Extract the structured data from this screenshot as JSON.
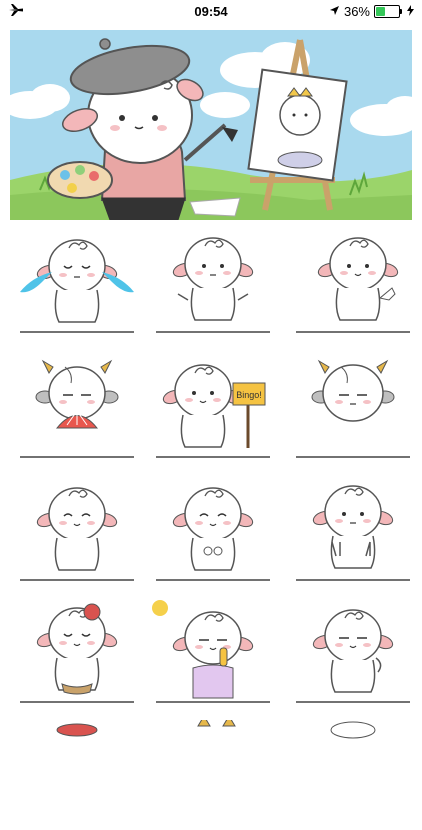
{
  "status_bar": {
    "time": "09:54",
    "battery_percent": "36%",
    "battery_level": 0.36,
    "icons": [
      "airplane-icon",
      "location-arrow-icon",
      "battery-icon",
      "charging-bolt-icon"
    ]
  },
  "banner": {
    "easel_sign": "",
    "colors": {
      "sky": "#a9d9ee",
      "grass": "#9bd46a",
      "beret": "#8e8e8e",
      "sweater": "#e8a6a4"
    }
  },
  "stickers": [
    {
      "name": "crying",
      "text": ""
    },
    {
      "name": "shrug",
      "text": ""
    },
    {
      "name": "thumbs-up",
      "text": ""
    },
    {
      "name": "cow-fan",
      "text": ""
    },
    {
      "name": "bingo-sign",
      "text": "Bingo!"
    },
    {
      "name": "cow-unimpressed",
      "text": ""
    },
    {
      "name": "smile",
      "text": ""
    },
    {
      "name": "hands-together",
      "text": ""
    },
    {
      "name": "peace-hands",
      "text": ""
    },
    {
      "name": "rose-bikini",
      "text": ""
    },
    {
      "name": "sunny-popsicle",
      "text": ""
    },
    {
      "name": "thinking",
      "text": ""
    },
    {
      "name": "partial-1",
      "text": ""
    },
    {
      "name": "partial-2",
      "text": ""
    },
    {
      "name": "partial-3",
      "text": ""
    }
  ]
}
